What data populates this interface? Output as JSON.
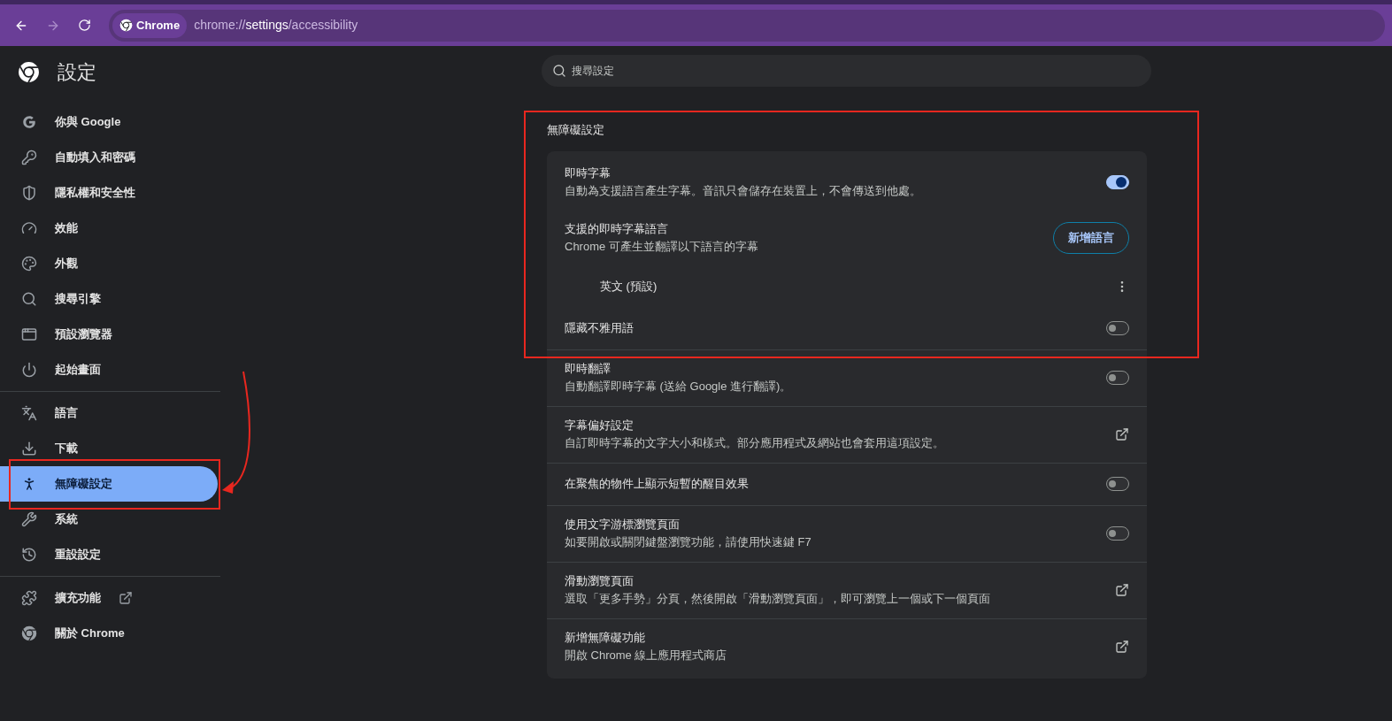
{
  "toolbar": {
    "site_chip": "Chrome",
    "url": "chrome://**settings**/accessibility"
  },
  "header": {
    "title": "設定"
  },
  "search": {
    "placeholder": "搜尋設定"
  },
  "sidebar": {
    "groups": [
      [
        {
          "label": "你與 Google",
          "selected": false
        },
        {
          "label": "自動填入和密碼",
          "selected": false
        },
        {
          "label": "隱私權和安全性",
          "selected": false
        },
        {
          "label": "效能",
          "selected": false
        },
        {
          "label": "外觀",
          "selected": false
        },
        {
          "label": "搜尋引擎",
          "selected": false
        },
        {
          "label": "預設瀏覽器",
          "selected": false
        },
        {
          "label": "起始畫面",
          "selected": false
        }
      ],
      [
        {
          "label": "語言",
          "selected": false
        },
        {
          "label": "下載",
          "selected": false
        },
        {
          "label": "無障礙設定",
          "selected": true
        },
        {
          "label": "系統",
          "selected": false
        },
        {
          "label": "重設設定",
          "selected": false
        }
      ],
      [
        {
          "label": "擴充功能",
          "selected": false,
          "external": true
        },
        {
          "label": "關於 Chrome",
          "selected": false,
          "external": false
        }
      ]
    ]
  },
  "section": {
    "title": "無障礙設定",
    "groups": [
      [
        {
          "kind": "toggle",
          "title": "即時字幕",
          "description": "自動為支援語言產生字幕。音訊只會儲存在裝置上，不會傳送到他處。",
          "on": true
        },
        {
          "kind": "button",
          "title": "支援的即時字幕語言",
          "description": "Chrome 可產生並翻譯以下語言的字幕",
          "button": "新增語言"
        },
        {
          "kind": "language",
          "title": "英文 (預設)"
        },
        {
          "kind": "toggle",
          "title": "隱藏不雅用語",
          "on": false
        }
      ],
      [
        {
          "kind": "toggle",
          "title": "即時翻譯",
          "description": "自動翻譯即時字幕 (送給 Google 進行翻譯)。",
          "on": false
        }
      ],
      [
        {
          "kind": "link",
          "title": "字幕偏好設定",
          "description": "自訂即時字幕的文字大小和樣式。部分應用程式及網站也會套用這項設定。"
        }
      ],
      [
        {
          "kind": "toggle",
          "title": "在聚焦的物件上顯示短暫的醒目效果",
          "on": false
        }
      ],
      [
        {
          "kind": "toggle",
          "title": "使用文字游標瀏覽頁面",
          "description": "如要開啟或關閉鍵盤瀏覽功能，請使用快速鍵 F7",
          "on": false
        }
      ],
      [
        {
          "kind": "link",
          "title": "滑動瀏覽頁面",
          "description": "選取「更多手勢」分頁，然後開啟「滑動瀏覽頁面」，即可瀏覽上一個或下一個頁面"
        }
      ],
      [
        {
          "kind": "link",
          "title": "新增無障礙功能",
          "description": "開啟 Chrome 線上應用程式商店"
        }
      ]
    ]
  }
}
